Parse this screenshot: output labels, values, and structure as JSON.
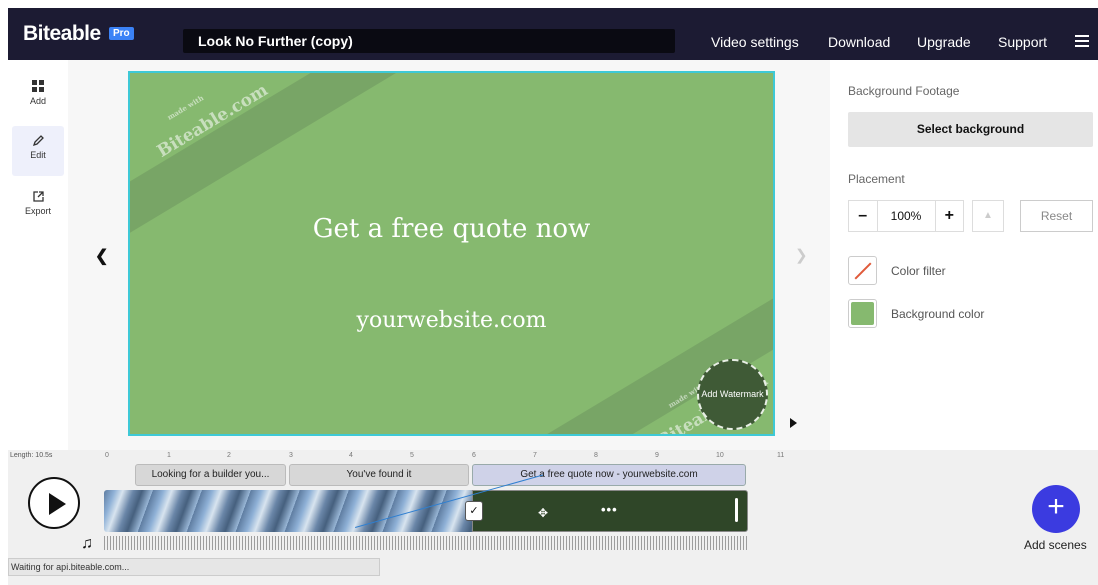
{
  "header": {
    "logo": "Biteable",
    "badge": "Pro",
    "project_title": "Look No Further (copy)",
    "nav": [
      "Video settings",
      "Download",
      "Upgrade",
      "Support"
    ]
  },
  "sidebar": {
    "items": [
      {
        "label": "Add",
        "icon": "grid-icon"
      },
      {
        "label": "Edit",
        "icon": "pencil-icon"
      },
      {
        "label": "Export",
        "icon": "export-icon"
      }
    ]
  },
  "canvas": {
    "line1": "Get a free quote now",
    "line2": "yourwebsite.com",
    "watermark_small": "made with",
    "watermark_big": "Biteable.com",
    "watermark_badge": "Add Watermark",
    "background_color": "#86b96f"
  },
  "panel": {
    "background_footage_label": "Background Footage",
    "select_background": "Select background",
    "placement_label": "Placement",
    "zoom_value": "100%",
    "reset": "Reset",
    "color_filter": "Color filter",
    "background_color": "Background color"
  },
  "timeline": {
    "length": "Length: 10.5s",
    "ticks": [
      "0",
      "1",
      "2",
      "3",
      "4",
      "5",
      "6",
      "7",
      "8",
      "9",
      "10",
      "11"
    ],
    "scenes": [
      "Looking for a builder you...",
      "You've found it",
      "Get a free quote now - yourwebsite.com"
    ],
    "add_scenes": "Add scenes",
    "status": "Waiting for api.biteable.com..."
  }
}
